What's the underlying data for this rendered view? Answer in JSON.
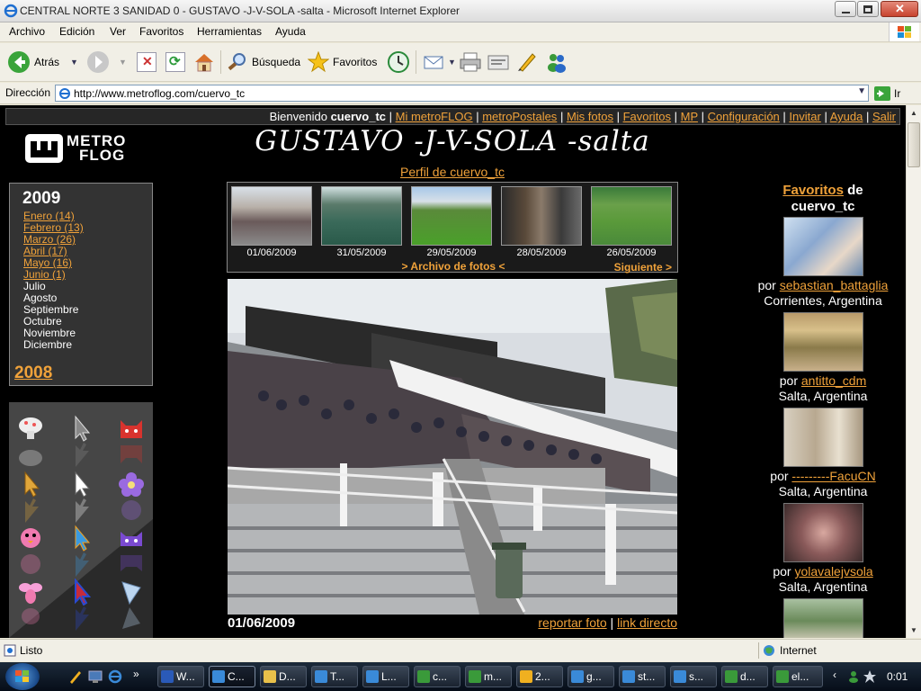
{
  "window": {
    "title": "CENTRAL NORTE 3 SANIDAD 0 - GUSTAVO -J-V-SOLA -salta - Microsoft Internet Explorer"
  },
  "menu": [
    "Archivo",
    "Edición",
    "Ver",
    "Favoritos",
    "Herramientas",
    "Ayuda"
  ],
  "toolbar": {
    "back": "Atrás",
    "search": "Búsqueda",
    "favorites": "Favoritos"
  },
  "address": {
    "label": "Dirección",
    "url": "http://www.metroflog.com/cuervo_tc",
    "go": "Ir"
  },
  "site": {
    "welcome": "Bienvenido",
    "user": "cuervo_tc",
    "nav": [
      "Mi metroFLOG",
      "metroPostales",
      "Mis fotos",
      "Favoritos",
      "MP",
      "Configuración",
      "Invitar",
      "Ayuda",
      "Salir"
    ],
    "logo_line1": "METRO",
    "logo_line2": "FLOG",
    "title": "GUSTAVO -J-V-SOLA -salta",
    "profile_link": "Perfil de cuervo_tc",
    "year_current": "2009",
    "months": [
      {
        "label": "Enero (14)",
        "link": true
      },
      {
        "label": "Febrero (13)",
        "link": true
      },
      {
        "label": "Marzo (26)",
        "link": true
      },
      {
        "label": "Abril (17)",
        "link": true
      },
      {
        "label": "Mayo (16)",
        "link": true
      },
      {
        "label": "Junio (1)",
        "link": true
      },
      {
        "label": "Julio",
        "link": false
      },
      {
        "label": "Agosto",
        "link": false
      },
      {
        "label": "Septiembre",
        "link": false
      },
      {
        "label": "Octubre",
        "link": false
      },
      {
        "label": "Noviembre",
        "link": false
      },
      {
        "label": "Diciembre",
        "link": false
      }
    ],
    "year_prev": "2008",
    "thumbs": [
      {
        "date": "01/06/2009"
      },
      {
        "date": "31/05/2009"
      },
      {
        "date": "29/05/2009"
      },
      {
        "date": "28/05/2009"
      },
      {
        "date": "26/05/2009"
      }
    ],
    "archive_link": ">  Archivo de fotos  <",
    "next_link": "Siguiente >",
    "photo_date": "01/06/2009",
    "report_link": "reportar foto",
    "direct_link": "link directo",
    "fav_title_link": "Favoritos",
    "fav_title_rest": " de",
    "fav_owner": "cuervo_tc",
    "favorites": [
      {
        "by": "por",
        "user": "sebastian_battaglia",
        "place": "Corrientes, Argentina"
      },
      {
        "by": "por",
        "user": "antitto_cdm",
        "place": "Salta, Argentina"
      },
      {
        "by": "por",
        "user": "---------FacuCN",
        "place": "Salta, Argentina"
      },
      {
        "by": "por",
        "user": "yolavalejvsola",
        "place": "Salta, Argentina"
      }
    ]
  },
  "status": {
    "text": "Listo",
    "zone": "Internet"
  },
  "taskbar": {
    "buttons": [
      "W...",
      "C...",
      "D...",
      "T...",
      "L...",
      "c...",
      "m...",
      "2...",
      "g...",
      "st...",
      "s...",
      "d...",
      "el..."
    ],
    "clock": "0:01"
  }
}
